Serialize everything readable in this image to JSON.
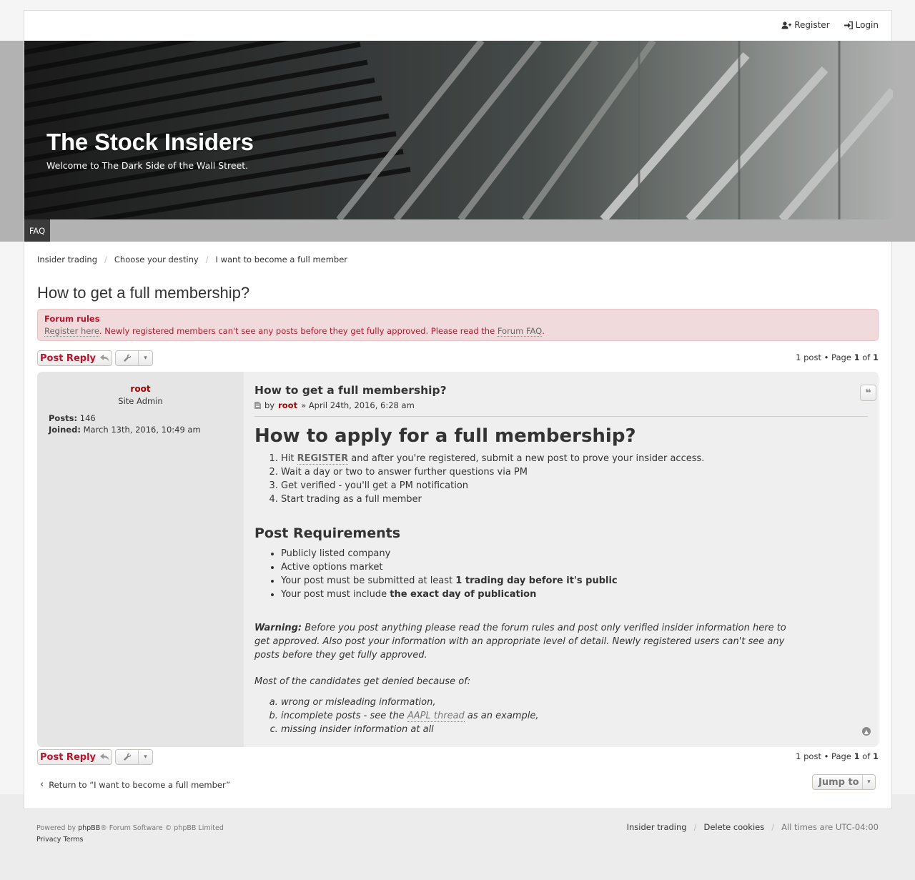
{
  "header": {
    "register_label": "Register",
    "login_label": "Login",
    "site_title": "The Stock Insiders",
    "site_description": "Welcome to The Dark Side of the Wall Street.",
    "nav_faq": "FAQ"
  },
  "breadcrumbs": [
    "Insider trading",
    "Choose your destiny",
    "I want to become a full member"
  ],
  "topic": {
    "title": "How to get a full membership?"
  },
  "rules": {
    "title": "Forum rules",
    "link1": "Register here",
    "text": ". Newly registered members can't see any posts before they get fully approved. Please read the ",
    "link2": "Forum FAQ",
    "end": "."
  },
  "actions": {
    "post_reply": "Post Reply",
    "pagination_prefix": "1 post • Page ",
    "page_current": "1",
    "pagination_of": " of ",
    "page_total": "1"
  },
  "post": {
    "author": "root",
    "rank": "Site Admin",
    "posts_label": "Posts:",
    "posts_value": "146",
    "joined_label": "Joined:",
    "joined_value": "March 13th, 2016, 10:49 am",
    "subject": "How to get a full membership?",
    "by": "by",
    "date": "» April 24th, 2016, 6:28 am",
    "h1": "How to apply for a full membership?",
    "step1_prefix": "Hit ",
    "step1_link": "REGISTER",
    "step1_suffix": " and after you're registered, submit a new post to prove your insider access.",
    "step2": "Wait a day or two to answer further questions via PM",
    "step3": "Get verified - you'll get a PM notification",
    "step4": "Start trading as a full member",
    "h2": "Post Requirements",
    "req1": "Publicly listed company",
    "req2": "Active options market",
    "req3_prefix": "Your post must be submitted at least ",
    "req3_bold": "1 trading day before it's public",
    "req4_prefix": "Your post must include ",
    "req4_bold": "the exact day of publication",
    "warning_label": "Warning:",
    "warning_text": " Before you post anything please read the forum rules and post only verified insider information here to get approved. Also post your information with an appropriate level of detail. Newly registered users can't see any posts before they get fully approved.",
    "most": "Most of the candidates get denied because of:",
    "reason_a": "wrong or misleading information,",
    "reason_b_prefix": "incomplete posts - see the ",
    "reason_b_link": "AAPL thread",
    "reason_b_suffix": " as an example,",
    "reason_c": "missing insider information at all"
  },
  "bottom": {
    "return_label": "Return to “I want to become a full member”",
    "jump_label": "Jump to"
  },
  "footer": {
    "powered_prefix": "Powered by ",
    "phpbb": "phpBB",
    "powered_suffix": "® Forum Software © phpBB Limited",
    "privacy": "Privacy",
    "terms": "Terms",
    "link_home": "Insider trading",
    "link_cookies": "Delete cookies",
    "timezone": "All times are UTC-04:00"
  },
  "colors": {
    "accent": "#b5152b",
    "author": "#aa0000",
    "rules_bg": "#f0dadc"
  }
}
